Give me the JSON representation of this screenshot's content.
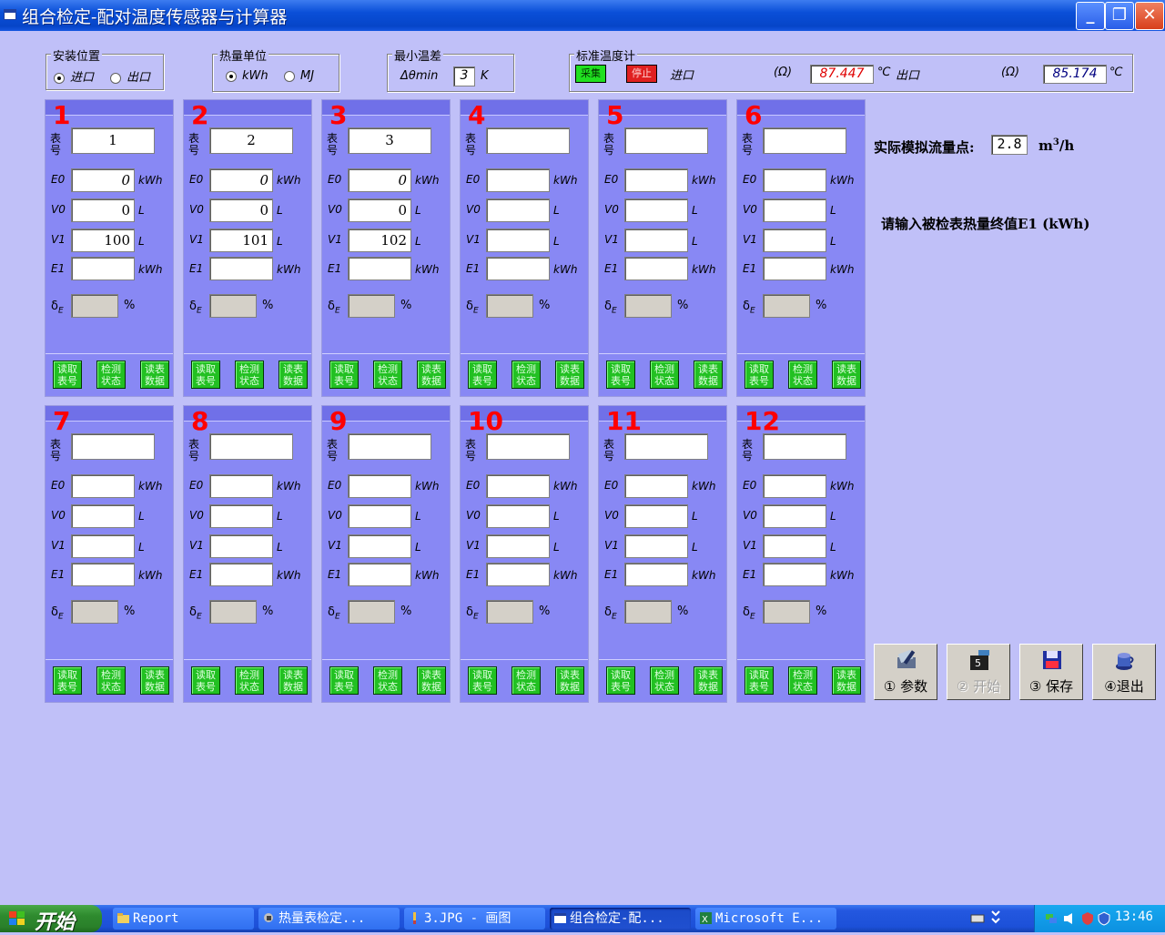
{
  "window": {
    "title": "组合检定-配对温度传感器与计算器",
    "minimize": "_",
    "maximize": "❐",
    "close": "✕"
  },
  "install": {
    "label": "安装位置",
    "options": [
      "进口",
      "出口"
    ],
    "selected": 0
  },
  "heat_unit": {
    "label": "热量单位",
    "options": [
      "kWh",
      "MJ"
    ],
    "selected": 0
  },
  "min_temp_diff": {
    "label": "最小温差",
    "symbol": "Δθmin",
    "value": "3",
    "unit": "K"
  },
  "std_thermometer": {
    "label": "标准温度计",
    "collect": "采集",
    "stop": "停止",
    "inlet_label": "进口",
    "ohm1": "(Ω)",
    "inlet_value": "87.447",
    "celsius1": "℃",
    "outlet_label": "出口",
    "ohm2": "(Ω)",
    "outlet_value": "85.174",
    "celsius2": "℃"
  },
  "row_labels": {
    "meter_no": "表号",
    "e0": "E0",
    "v0": "V0",
    "v1": "V1",
    "e1": "E1",
    "delta": "δ",
    "delta_sub": "E",
    "pct": "%"
  },
  "units": {
    "kwh": "kWh",
    "l": "L"
  },
  "panel_buttons": [
    "读取表号",
    "检测状态",
    "读表数据"
  ],
  "panels": [
    {
      "num": "1",
      "id": "1",
      "e0": "0",
      "v0": "0",
      "v1": "100",
      "e1": ""
    },
    {
      "num": "2",
      "id": "2",
      "e0": "0",
      "v0": "0",
      "v1": "101",
      "e1": ""
    },
    {
      "num": "3",
      "id": "3",
      "e0": "0",
      "v0": "0",
      "v1": "102",
      "e1": ""
    },
    {
      "num": "4",
      "id": "",
      "e0": "",
      "v0": "",
      "v1": "",
      "e1": ""
    },
    {
      "num": "5",
      "id": "",
      "e0": "",
      "v0": "",
      "v1": "",
      "e1": ""
    },
    {
      "num": "6",
      "id": "",
      "e0": "",
      "v0": "",
      "v1": "",
      "e1": ""
    },
    {
      "num": "7",
      "id": "",
      "e0": "",
      "v0": "",
      "v1": "",
      "e1": ""
    },
    {
      "num": "8",
      "id": "",
      "e0": "",
      "v0": "",
      "v1": "",
      "e1": ""
    },
    {
      "num": "9",
      "id": "",
      "e0": "",
      "v0": "",
      "v1": "",
      "e1": ""
    },
    {
      "num": "10",
      "id": "",
      "e0": "",
      "v0": "",
      "v1": "",
      "e1": ""
    },
    {
      "num": "11",
      "id": "",
      "e0": "",
      "v0": "",
      "v1": "",
      "e1": ""
    },
    {
      "num": "12",
      "id": "",
      "e0": "",
      "v0": "",
      "v1": "",
      "e1": ""
    }
  ],
  "flow": {
    "label": "实际模拟流量点:",
    "value": "2.8",
    "unit_pre": "m",
    "unit_sup": "3",
    "unit_post": "/h"
  },
  "prompt": "请输入被检表热量终值E1 (kWh)",
  "actions": [
    {
      "label": "① 参数",
      "icon": "params-icon",
      "enabled": true
    },
    {
      "label": "② 开始",
      "icon": "start-icon",
      "enabled": false
    },
    {
      "label": "③ 保存",
      "icon": "save-icon",
      "enabled": true
    },
    {
      "label": "④退出",
      "icon": "exit-icon",
      "enabled": true
    }
  ],
  "taskbar": {
    "start": "开始",
    "items": [
      "Report",
      "热量表检定...",
      "3.JPG - 画图",
      "组合检定-配...",
      "Microsoft E..."
    ],
    "active": 3,
    "clock": "13:46"
  }
}
